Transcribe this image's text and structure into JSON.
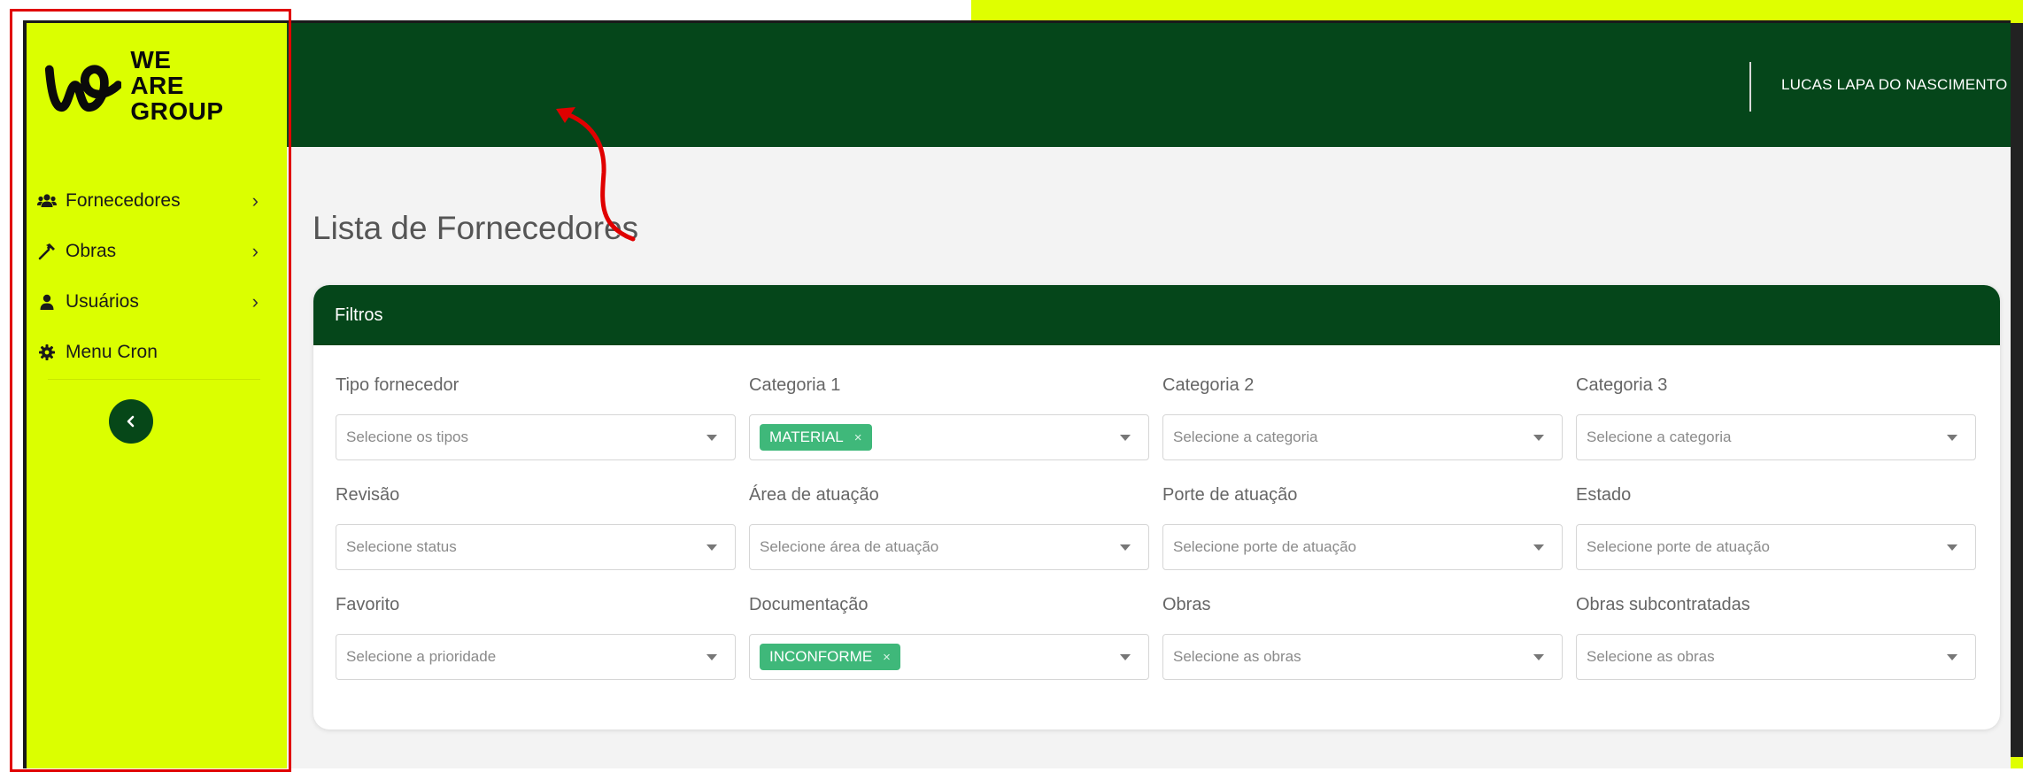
{
  "brand": {
    "line1": "WE ARE",
    "line2": "GROUP"
  },
  "sidebar": {
    "items": [
      {
        "label": "Fornecedores",
        "icon": "users-icon",
        "chevron": "›"
      },
      {
        "label": "Obras",
        "icon": "hammer-icon",
        "chevron": "›"
      },
      {
        "label": "Usuários",
        "icon": "user-icon",
        "chevron": "›"
      },
      {
        "label": "Menu Cron",
        "icon": "gear-icon",
        "chevron": ""
      }
    ],
    "collapse_icon": "chevron-left-icon"
  },
  "header": {
    "user_name": "LUCAS LAPA DO NASCIMENTO"
  },
  "main": {
    "title": "Lista de Fornecedores"
  },
  "filters": {
    "title": "Filtros",
    "fields": [
      {
        "label": "Tipo fornecedor",
        "placeholder": "Selecione os tipos",
        "tag": ""
      },
      {
        "label": "Categoria 1",
        "placeholder": "",
        "tag": "MATERIAL"
      },
      {
        "label": "Categoria 2",
        "placeholder": "Selecione a categoria",
        "tag": ""
      },
      {
        "label": "Categoria 3",
        "placeholder": "Selecione a categoria",
        "tag": ""
      },
      {
        "label": "Revisão",
        "placeholder": "Selecione status",
        "tag": ""
      },
      {
        "label": "Área de atuação",
        "placeholder": "Selecione área de atuação",
        "tag": ""
      },
      {
        "label": "Porte de atuação",
        "placeholder": "Selecione porte de atuação",
        "tag": ""
      },
      {
        "label": "Estado",
        "placeholder": "Selecione porte de atuação",
        "tag": ""
      },
      {
        "label": "Favorito",
        "placeholder": "Selecione a prioridade",
        "tag": ""
      },
      {
        "label": "Documentação",
        "placeholder": "",
        "tag": "INCONFORME"
      },
      {
        "label": "Obras",
        "placeholder": "Selecione as obras",
        "tag": ""
      },
      {
        "label": "Obras subcontratadas",
        "placeholder": "Selecione as obras",
        "tag": ""
      }
    ],
    "tag_remove": "×"
  },
  "colors": {
    "brand_lime": "#dbff00",
    "header_green": "#05461a",
    "tag_green": "#3fb87a",
    "annotation_red": "#e00000"
  }
}
